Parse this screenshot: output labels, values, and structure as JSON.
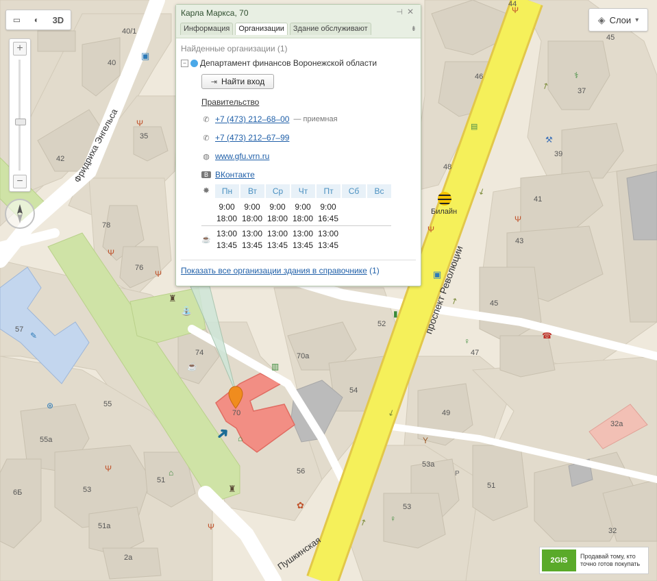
{
  "colors": {
    "background": "#efe9dc",
    "block": "#e2dbcc",
    "building": "#d9d2c3",
    "green": "#cfe3a6",
    "avenue": "#f5f05a",
    "avenue_border": "#e2c74a",
    "highlight": "#f28e84",
    "school": "#c3d6ee",
    "accent": "#4a90c0",
    "popup_header": "#e8efe3"
  },
  "toolbar": {
    "ruler_icon": "ruler-icon",
    "traffic_icon": "swirl-icon",
    "label_3d": "3D"
  },
  "zoom": {
    "plus": "+",
    "minus": "−",
    "level": 0.47
  },
  "layers": {
    "label": "Слои",
    "arrow": "▾"
  },
  "popup": {
    "title": "Карла Маркса, 70",
    "pin": "⊣",
    "close": "✕",
    "tabs": [
      "Информация",
      "Организации",
      "Здание обслуживают"
    ],
    "active_tab": 1,
    "more": "⇟",
    "found": "Найденные организации (1)",
    "collapse": "⊟",
    "org_name": "Департамент финансов Воронежской области",
    "route_button": "Найти вход",
    "category": "Правительство",
    "contacts": [
      {
        "icon": "phone-icon",
        "text": "+7 (473) 212–68–00",
        "note": "— приемная"
      },
      {
        "icon": "phone-icon",
        "text": "+7 (473) 212–67–99",
        "note": ""
      },
      {
        "icon": "globe-icon",
        "text": "www.gfu.vrn.ru",
        "note": ""
      },
      {
        "icon": "vk-icon",
        "text": "ВКонтакте",
        "note": ""
      }
    ],
    "hours": {
      "days": [
        "Пн",
        "Вт",
        "Ср",
        "Чт",
        "Пт",
        "Сб",
        "Вс"
      ],
      "work": [
        [
          "9:00",
          "18:00"
        ],
        [
          "9:00",
          "18:00"
        ],
        [
          "9:00",
          "18:00"
        ],
        [
          "9:00",
          "18:00"
        ],
        [
          "9:00",
          "16:45"
        ]
      ],
      "lunch": [
        [
          "13:00",
          "13:45"
        ],
        [
          "13:00",
          "13:45"
        ],
        [
          "13:00",
          "13:45"
        ],
        [
          "13:00",
          "13:45"
        ],
        [
          "13:00",
          "13:45"
        ]
      ]
    },
    "show_all_link": "Показать все организации здания в справочнике",
    "show_all_count": "(1)"
  },
  "streets": [
    {
      "name": "Фридриха Энгельса"
    },
    {
      "name": "проспект Революции"
    },
    {
      "name": "Пушкинская"
    }
  ],
  "house_numbers": [
    "44",
    "45",
    "40/1",
    "40",
    "46",
    "37",
    "42",
    "35",
    "48",
    "39",
    "41",
    "78",
    "76",
    "43",
    "45",
    "57",
    "74",
    "70а",
    "52",
    "47",
    "54",
    "55",
    "70",
    "49",
    "32а",
    "55а",
    "56",
    "53а",
    "6Б",
    "53",
    "51",
    "51",
    "53",
    "51а",
    "32",
    "2а"
  ],
  "poi": {
    "label": "Билайн"
  },
  "promo": {
    "logo": "2GIS",
    "line1": "Продавай тому, кто",
    "line2": "точно готов покупать"
  }
}
